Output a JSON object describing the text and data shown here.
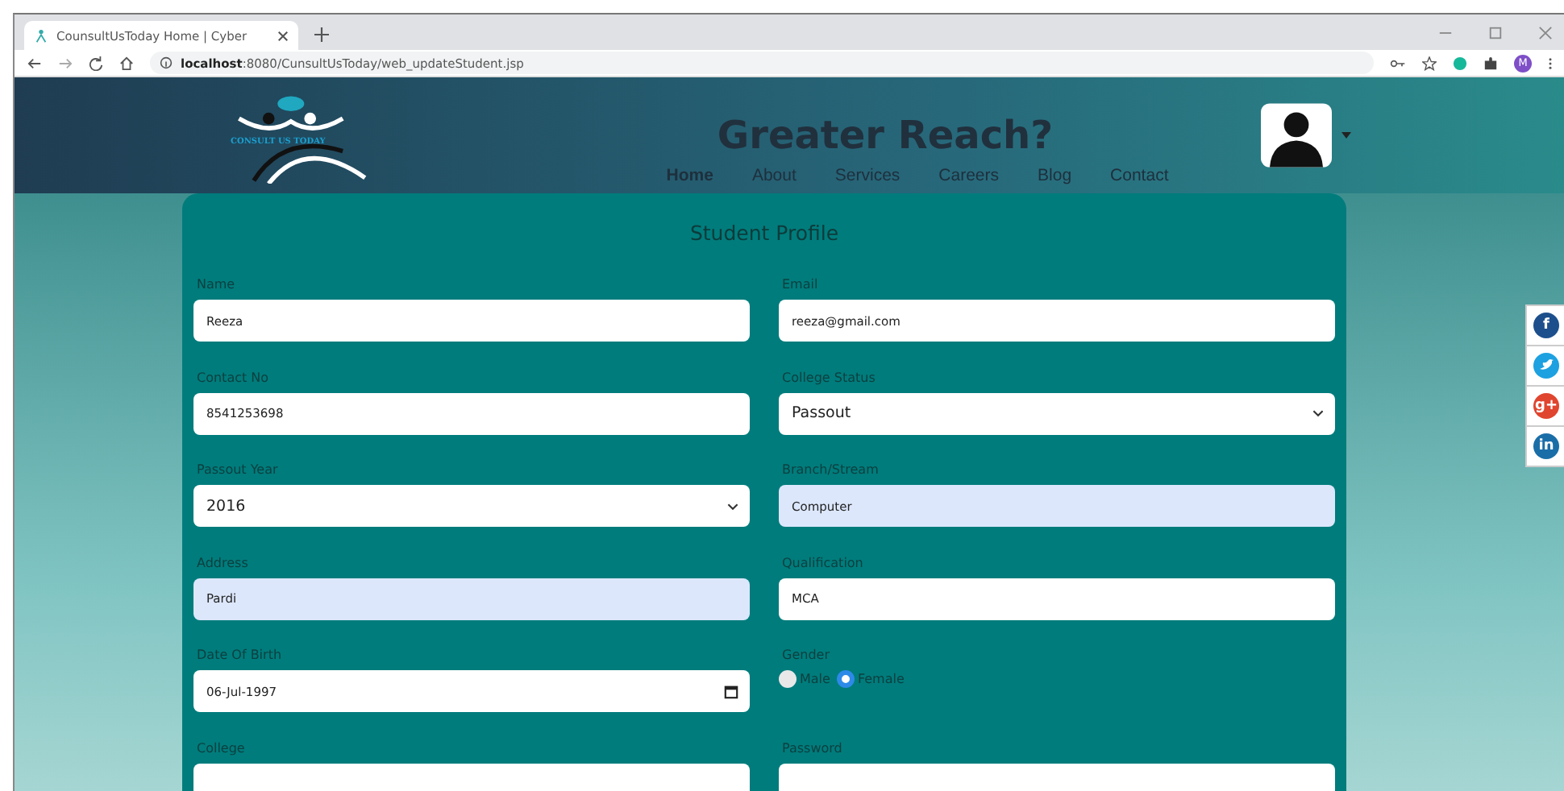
{
  "browser": {
    "tab_title": "CounsultUsToday Home | Cyber",
    "url_host": "localhost",
    "url_path": ":8080/CunsultUsToday/web_updateStudent.jsp",
    "profile_initial": "M"
  },
  "header": {
    "logo_text": "CONSULT US TODAY",
    "heading": "Greater Reach?",
    "nav": [
      {
        "label": "Home",
        "selected": true
      },
      {
        "label": "About",
        "selected": false
      },
      {
        "label": "Services",
        "selected": false
      },
      {
        "label": "Careers",
        "selected": false
      },
      {
        "label": "Blog",
        "selected": false
      },
      {
        "label": "Contact",
        "selected": false
      }
    ]
  },
  "form": {
    "title": "Student Profile",
    "fields": [
      {
        "label": "Name",
        "kind": "text",
        "value": "Reeza",
        "autofilled": false
      },
      {
        "label": "Email",
        "kind": "text",
        "value": "reeza@gmail.com",
        "autofilled": false
      },
      {
        "label": "Contact No",
        "kind": "text",
        "value": "8541253698",
        "autofilled": false
      },
      {
        "label": "College Status",
        "kind": "select",
        "value": "Passout"
      },
      {
        "label": "Passout Year",
        "kind": "select",
        "value": "2016"
      },
      {
        "label": "Branch/Stream",
        "kind": "text",
        "value": "Computer",
        "autofilled": true
      },
      {
        "label": "Address",
        "kind": "text",
        "value": "Pardi",
        "autofilled": true
      },
      {
        "label": "Qualification",
        "kind": "text",
        "value": "MCA",
        "autofilled": false
      },
      {
        "label": "Date Of Birth",
        "kind": "date",
        "value": "06-Jul-1997"
      },
      {
        "label": "Gender",
        "kind": "radio",
        "options": [
          {
            "label": "Male",
            "selected": false
          },
          {
            "label": "Female",
            "selected": true
          }
        ]
      },
      {
        "label": "College",
        "kind": "text",
        "autofilled": false
      },
      {
        "label": "Password",
        "kind": "text",
        "autofilled": false
      }
    ]
  },
  "social": [
    {
      "kind": "glyph",
      "glyph": "f",
      "color": "#1d4f8c"
    },
    {
      "kind": "bird",
      "color": "#1da1e0"
    },
    {
      "kind": "glyph",
      "glyph": "g+",
      "color": "#e0452f"
    },
    {
      "kind": "glyph",
      "glyph": "in",
      "color": "#1a6ea8"
    }
  ]
}
